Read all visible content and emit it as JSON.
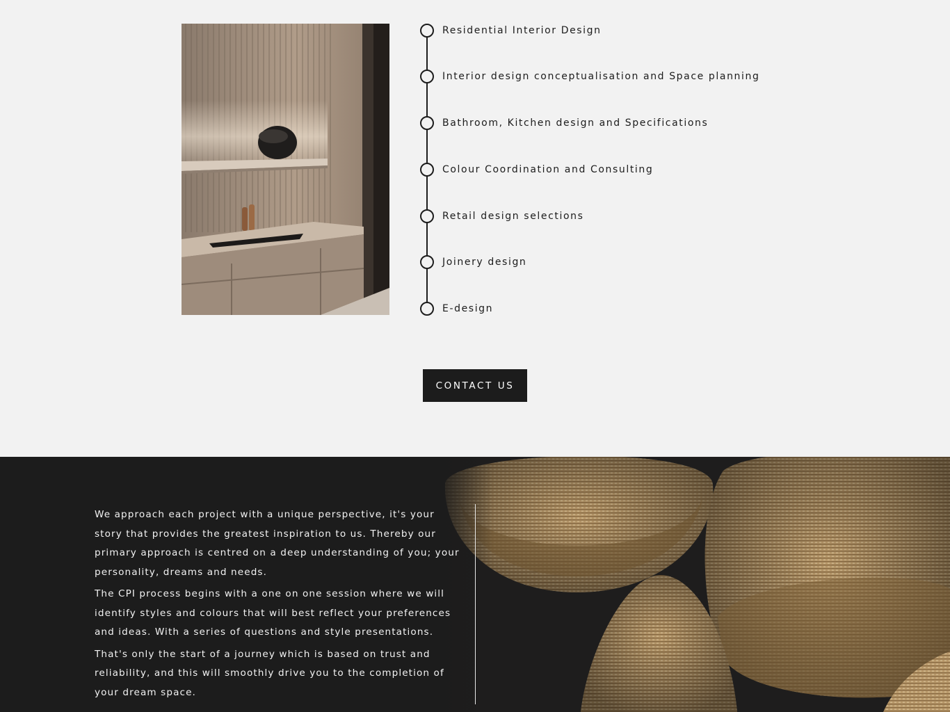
{
  "services": {
    "items": [
      {
        "label": "Residential Interior Design"
      },
      {
        "label": "Interior design conceptualisation and Space planning"
      },
      {
        "label": "Bathroom, Kitchen design and Specifications"
      },
      {
        "label": "Colour Coordination and Consulting"
      },
      {
        "label": "Retail design selections"
      },
      {
        "label": "Joinery design"
      },
      {
        "label": "E-design"
      }
    ]
  },
  "cta": {
    "label": "CONTACT US"
  },
  "about": {
    "paragraphs": [
      "We approach each project with a unique perspective, it's your story that provides the greatest inspiration to us. Thereby our primary approach is centred on a deep understanding of you; your personality, dreams and needs.",
      "The CPI process begins with a one on one session where we will identify styles and colours that will best reflect your preferences and ideas. With a series of questions and style presentations.",
      "That's only the start of a journey which is based on trust and reliability, and this will smoothly drive you to the completion of your dream space."
    ]
  },
  "colors": {
    "page_background": "#f2f2f2",
    "dark_section": "#1c1c1c",
    "text_dark": "#1c1c1c",
    "text_light": "#f2f2f2"
  }
}
